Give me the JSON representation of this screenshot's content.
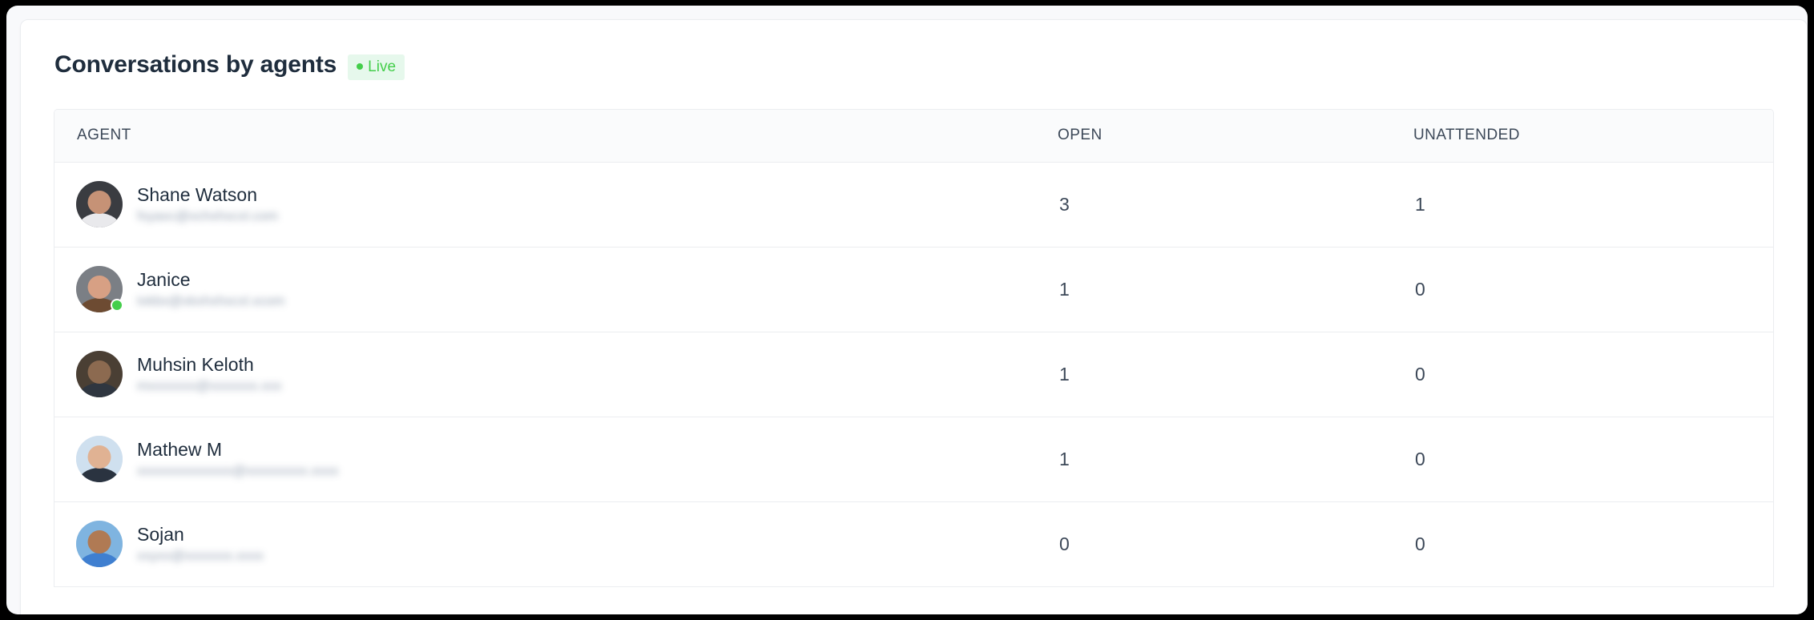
{
  "card": {
    "title": "Conversations by agents",
    "badge": {
      "label": "Live",
      "dot_icon": "live-dot-icon",
      "text_color": "#44ce4b",
      "background_color": "#e6f8ec"
    }
  },
  "table": {
    "columns": [
      {
        "key": "agent",
        "label": "AGENT"
      },
      {
        "key": "open",
        "label": "OPEN"
      },
      {
        "key": "unattended",
        "label": "UNATTENDED"
      }
    ],
    "rows": [
      {
        "name": "Shane Watson",
        "email": "fxyaxc@xchxhxcxl.com",
        "email_redacted": true,
        "online": false,
        "avatar": "agent-photo-shane-watson",
        "open": "3",
        "unattended": "1"
      },
      {
        "name": "Janice",
        "email": "txkbx@xkxhxhxcxl.xcom",
        "email_redacted": true,
        "online": true,
        "avatar": "agent-photo-janice",
        "open": "1",
        "unattended": "0"
      },
      {
        "name": "Muhsin Keloth",
        "email": "mxxxxxxx@xxxxxxx.xxx",
        "email_redacted": true,
        "online": false,
        "avatar": "agent-photo-muhsin-keloth",
        "open": "1",
        "unattended": "0"
      },
      {
        "name": "Mathew M",
        "email": "xxxxxxxxxxxxxx@xxxxxxxxx.xxxx",
        "email_redacted": true,
        "online": false,
        "avatar": "agent-photo-mathew-m",
        "open": "1",
        "unattended": "0"
      },
      {
        "name": "Sojan",
        "email": "xxyxx@xxxxxxx.xxxx",
        "email_redacted": true,
        "online": false,
        "avatar": "agent-photo-sojan",
        "open": "0",
        "unattended": "0"
      }
    ]
  },
  "colors": {
    "accent_green": "#44ce4b",
    "badge_bg": "#e6f8ec",
    "heading": "#1f2d3d",
    "body_text": "#3c4858",
    "muted_text": "#8492a6",
    "border": "#ebedf0",
    "header_row_bg": "#fafbfc",
    "card_bg": "#ffffff",
    "page_bg": "#f8f9fb"
  },
  "avatar_palettes": {
    "agent-photo-shane-watson": {
      "bg": "#3a3c41",
      "skin": "#c69276",
      "body": "#e9e9ec"
    },
    "agent-photo-janice": {
      "bg": "#7b7f85",
      "skin": "#d7a084",
      "body": "#6d4b32"
    },
    "agent-photo-muhsin-keloth": {
      "bg": "#4a3f34",
      "skin": "#8c6a50",
      "body": "#2f3640"
    },
    "agent-photo-mathew-m": {
      "bg": "#cfe0ef",
      "skin": "#e0b293",
      "body": "#2a3340"
    },
    "agent-photo-sojan": {
      "bg": "#7fb4e0",
      "skin": "#b07a54",
      "body": "#3f7fd0"
    }
  }
}
